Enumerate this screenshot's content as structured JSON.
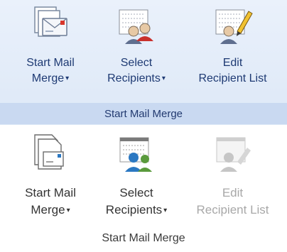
{
  "ribbon_2010": {
    "buttons": [
      {
        "line1": "Start Mail",
        "line2": "Merge",
        "caret": "▾",
        "icon": "envelope-documents-icon"
      },
      {
        "line1": "Select",
        "line2": "Recipients",
        "caret": "▾",
        "icon": "select-recipients-icon"
      },
      {
        "line1": "Edit",
        "line2": "Recipient List",
        "caret": "",
        "icon": "edit-recipient-list-icon"
      }
    ],
    "group_label": "Start Mail Merge",
    "colors": {
      "background": "#dde8f7",
      "footer": "#c9d9f1",
      "text": "#1e3a73"
    }
  },
  "ribbon_2013": {
    "buttons": [
      {
        "line1": "Start Mail",
        "line2": "Merge",
        "caret": "▾",
        "icon": "document-envelope-icon",
        "enabled": true
      },
      {
        "line1": "Select",
        "line2": "Recipients",
        "caret": "▾",
        "icon": "select-recipients-icon",
        "enabled": true
      },
      {
        "line1": "Edit",
        "line2": "Recipient List",
        "caret": "",
        "icon": "edit-recipient-list-icon",
        "enabled": false
      }
    ],
    "group_label": "Start Mail Merge",
    "colors": {
      "text": "#333333",
      "disabled_text": "#a8a8a8",
      "accent_blue": "#2b78c2",
      "accent_green": "#5a9a3c"
    }
  }
}
